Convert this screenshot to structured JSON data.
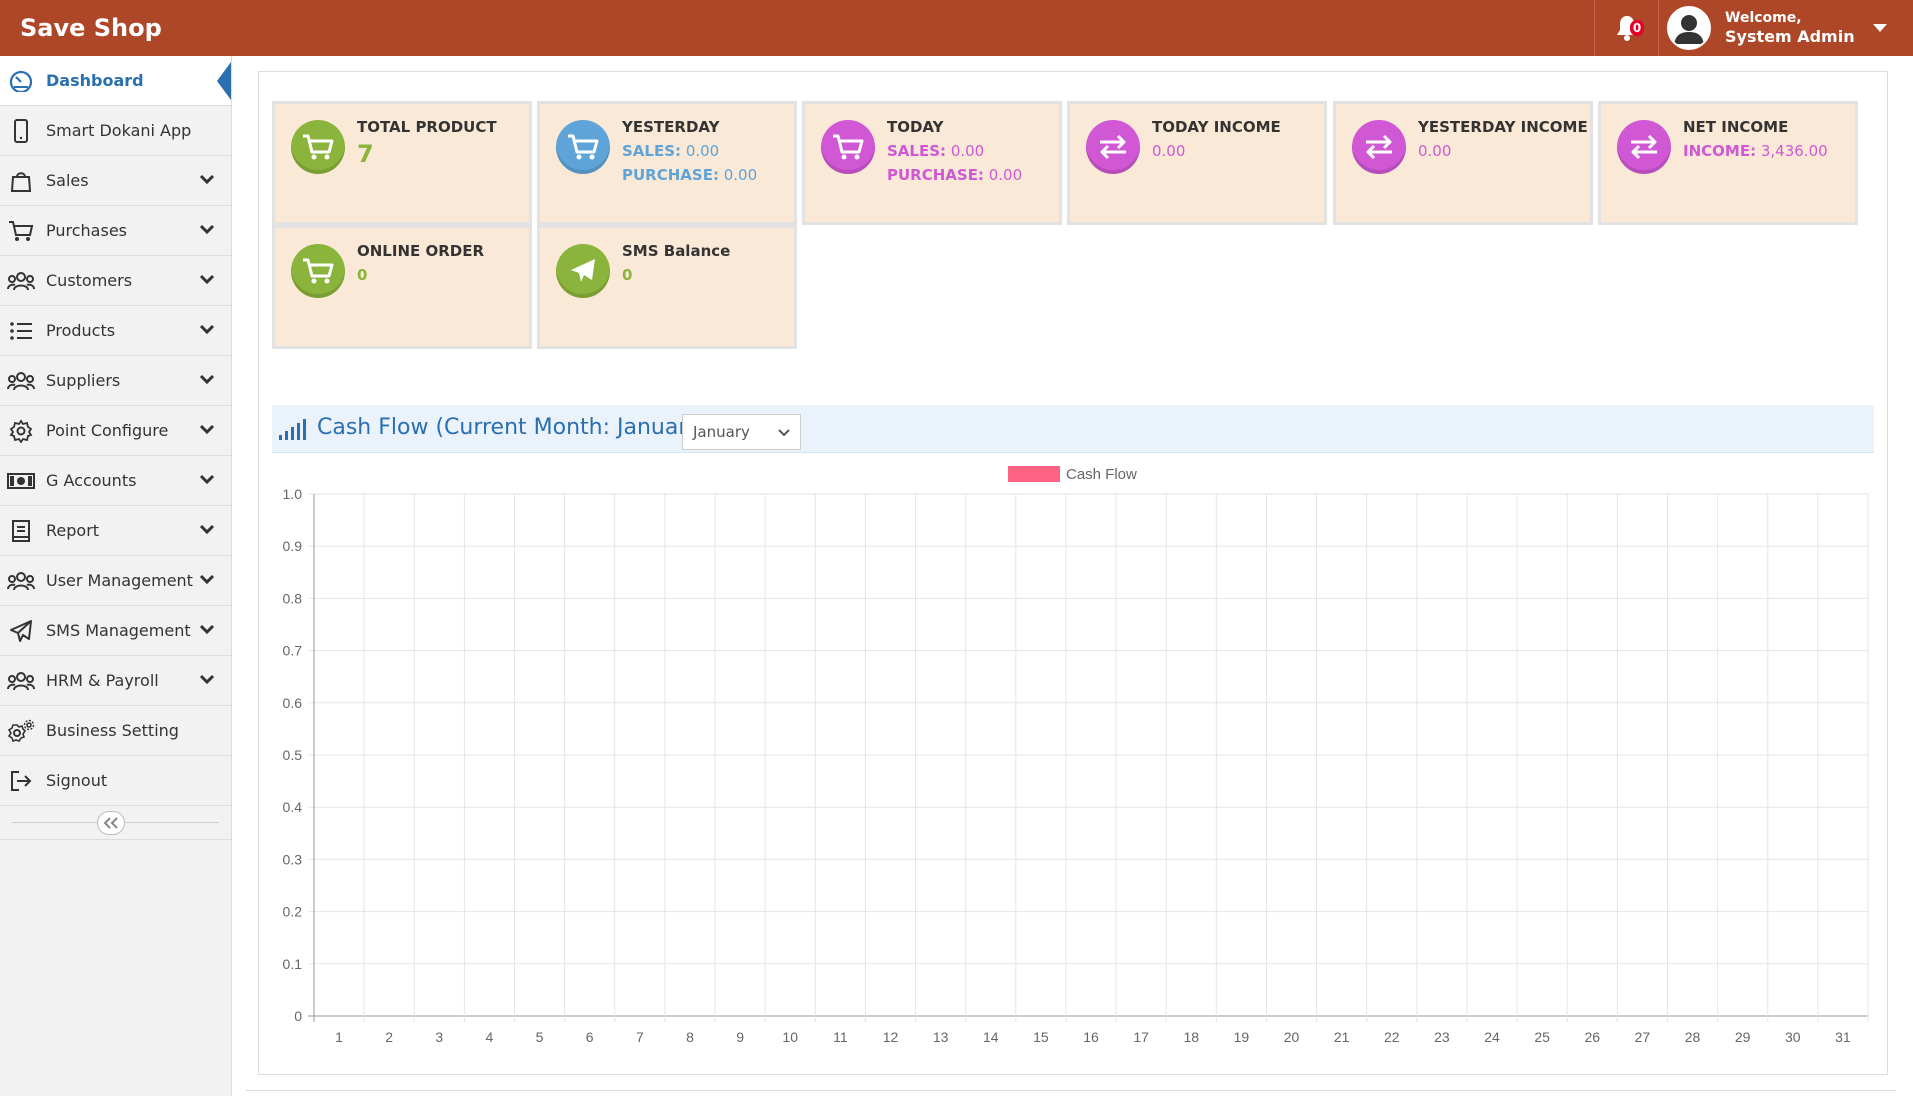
{
  "header": {
    "brand": "Save Shop",
    "notification_count": "0",
    "welcome_label": "Welcome,",
    "user_name": "System Admin"
  },
  "sidebar": {
    "items": [
      {
        "label": "Dashboard",
        "icon": "dashboard-gauge-icon",
        "active": true,
        "has_submenu": false
      },
      {
        "label": "Smart Dokani App",
        "icon": "mobile-phone-icon",
        "active": false,
        "has_submenu": false
      },
      {
        "label": "Sales",
        "icon": "shopping-bag-icon",
        "active": false,
        "has_submenu": true
      },
      {
        "label": "Purchases",
        "icon": "cart-icon",
        "active": false,
        "has_submenu": true
      },
      {
        "label": "Customers",
        "icon": "users-icon",
        "active": false,
        "has_submenu": true
      },
      {
        "label": "Products",
        "icon": "list-icon",
        "active": false,
        "has_submenu": true
      },
      {
        "label": "Suppliers",
        "icon": "users-icon",
        "active": false,
        "has_submenu": true
      },
      {
        "label": "Point Configure",
        "icon": "gear-icon",
        "active": false,
        "has_submenu": true
      },
      {
        "label": "G Accounts",
        "icon": "money-bill-icon",
        "active": false,
        "has_submenu": true
      },
      {
        "label": "Report",
        "icon": "report-book-icon",
        "active": false,
        "has_submenu": true
      },
      {
        "label": "User Management",
        "icon": "users-icon",
        "active": false,
        "has_submenu": true
      },
      {
        "label": "SMS Management",
        "icon": "paper-plane-icon",
        "active": false,
        "has_submenu": true
      },
      {
        "label": "HRM & Payroll",
        "icon": "users-icon",
        "active": false,
        "has_submenu": true
      },
      {
        "label": "Business Setting",
        "icon": "gears-icon",
        "active": false,
        "has_submenu": false
      },
      {
        "label": "Signout",
        "icon": "signout-icon",
        "active": false,
        "has_submenu": false
      }
    ]
  },
  "cards": {
    "total_product": {
      "title": "TOTAL PRODUCT",
      "value": "7"
    },
    "yesterday": {
      "title": "YESTERDAY",
      "sales_label": "SALES:",
      "sales_value": "0.00",
      "purchase_label": "PURCHASE:",
      "purchase_value": "0.00"
    },
    "today": {
      "title": "TODAY",
      "sales_label": "SALES:",
      "sales_value": "0.00",
      "purchase_label": "PURCHASE:",
      "purchase_value": "0.00"
    },
    "today_income": {
      "title": "TODAY INCOME",
      "value": "0.00"
    },
    "yesterday_income": {
      "title": "YESTERDAY INCOME",
      "value": "0.00"
    },
    "net_income": {
      "title": "NET INCOME",
      "income_label": "INCOME:",
      "income_value": "3,436.00"
    },
    "online_order": {
      "title": "ONLINE ORDER",
      "value": "0"
    },
    "sms_balance": {
      "title": "SMS Balance",
      "value": "0"
    }
  },
  "colors": {
    "header_bg": "#ae4728",
    "card_bg": "#fbe9d7",
    "green": "#8bb43c",
    "blue": "#5ea4d9",
    "pink": "#d058d4",
    "accent_blue": "#2a6fb0",
    "legend_color": "#ff6384"
  },
  "cashflow": {
    "title": "Cash Flow (Current Month: January)",
    "month_selected": "January"
  },
  "chart_data": {
    "type": "bar",
    "legend": [
      "Cash Flow"
    ],
    "legend_position": "top-center",
    "categories": [
      "1",
      "2",
      "3",
      "4",
      "5",
      "6",
      "7",
      "8",
      "9",
      "10",
      "11",
      "12",
      "13",
      "14",
      "15",
      "16",
      "17",
      "18",
      "19",
      "20",
      "21",
      "22",
      "23",
      "24",
      "25",
      "26",
      "27",
      "28",
      "29",
      "30",
      "31"
    ],
    "series": [
      {
        "name": "Cash Flow",
        "values": []
      }
    ],
    "y_ticks": [
      "0",
      "0.1",
      "0.2",
      "0.3",
      "0.4",
      "0.5",
      "0.6",
      "0.7",
      "0.8",
      "0.9",
      "1.0"
    ],
    "ylim": [
      0,
      1.0
    ],
    "grid": true
  }
}
